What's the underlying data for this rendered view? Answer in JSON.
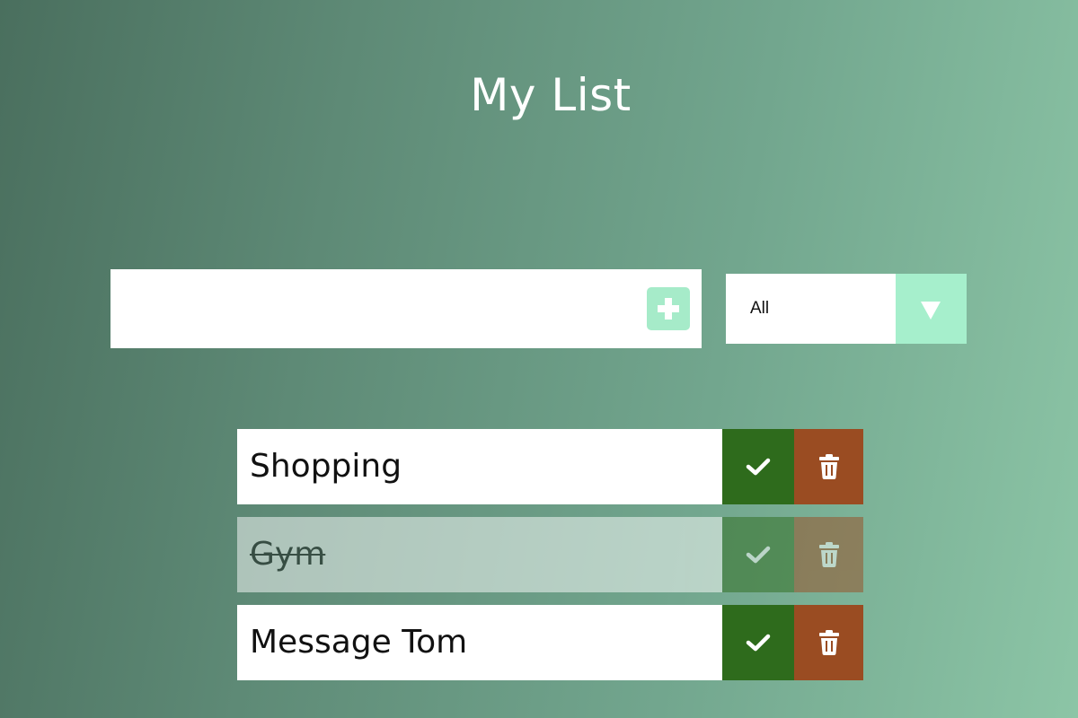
{
  "header": {
    "title": "My List"
  },
  "form": {
    "input_value": "",
    "add_icon": "plus-icon",
    "filter": {
      "selected": "All",
      "arrow_icon": "caret-down-icon"
    }
  },
  "todos": [
    {
      "text": "Shopping",
      "completed": false
    },
    {
      "text": "Gym",
      "completed": true
    },
    {
      "text": "Message Tom",
      "completed": false
    }
  ],
  "colors": {
    "accent_mint": "#a6ebc9",
    "complete_green": "#2e6b1c",
    "delete_brown": "#9a4c22",
    "gradient_start": "#4a6f5e",
    "gradient_end": "#8cc5a6"
  },
  "icons": {
    "complete": "check-icon",
    "delete": "trash-icon"
  }
}
